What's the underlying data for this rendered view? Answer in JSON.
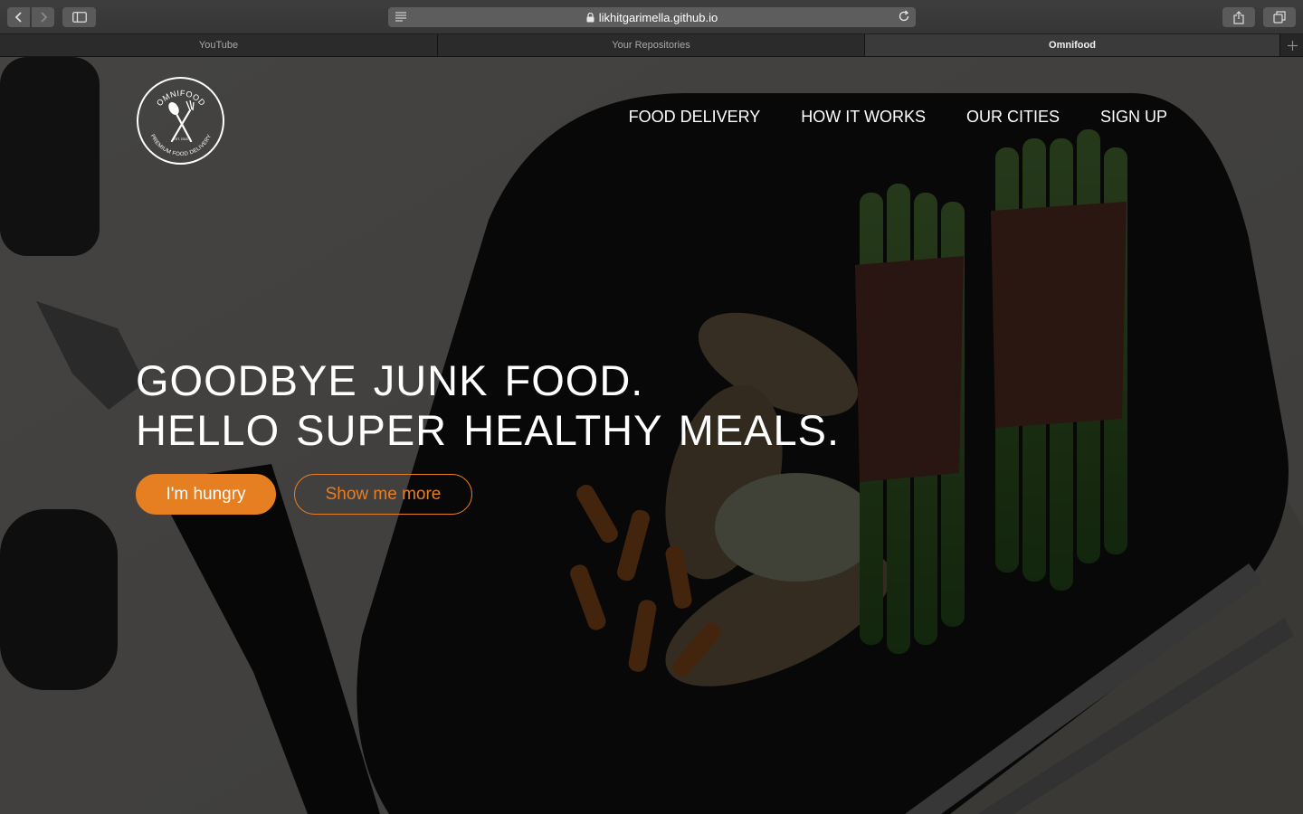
{
  "browser": {
    "url": "likhitgarimella.github.io",
    "tabs": [
      {
        "label": "YouTube",
        "active": false
      },
      {
        "label": "Your Repositories",
        "active": false
      },
      {
        "label": "Omnifood",
        "active": true
      }
    ],
    "icons": [
      "back-icon",
      "forward-icon",
      "sidebar-icon",
      "reader-icon",
      "lock-icon",
      "reload-icon",
      "share-icon",
      "tabs-overview-icon",
      "new-tab-icon"
    ]
  },
  "site": {
    "logo": {
      "top_text": "OMNIFOOD",
      "bottom_text": "PREMIUM FOOD DELIVERY",
      "est": "EST. 2015"
    },
    "nav": [
      {
        "label": "FOOD DELIVERY"
      },
      {
        "label": "HOW IT WORKS"
      },
      {
        "label": "OUR CITIES"
      },
      {
        "label": "SIGN UP"
      }
    ],
    "hero": {
      "line1": "GOODBYE JUNK FOOD.",
      "line2": "HELLO SUPER HEALTHY MEALS.",
      "primary_button": "I'm hungry",
      "secondary_button": "Show me more"
    }
  },
  "colors": {
    "accent": "#e67e22",
    "overlay": "rgba(0,0,0,0.70)"
  }
}
